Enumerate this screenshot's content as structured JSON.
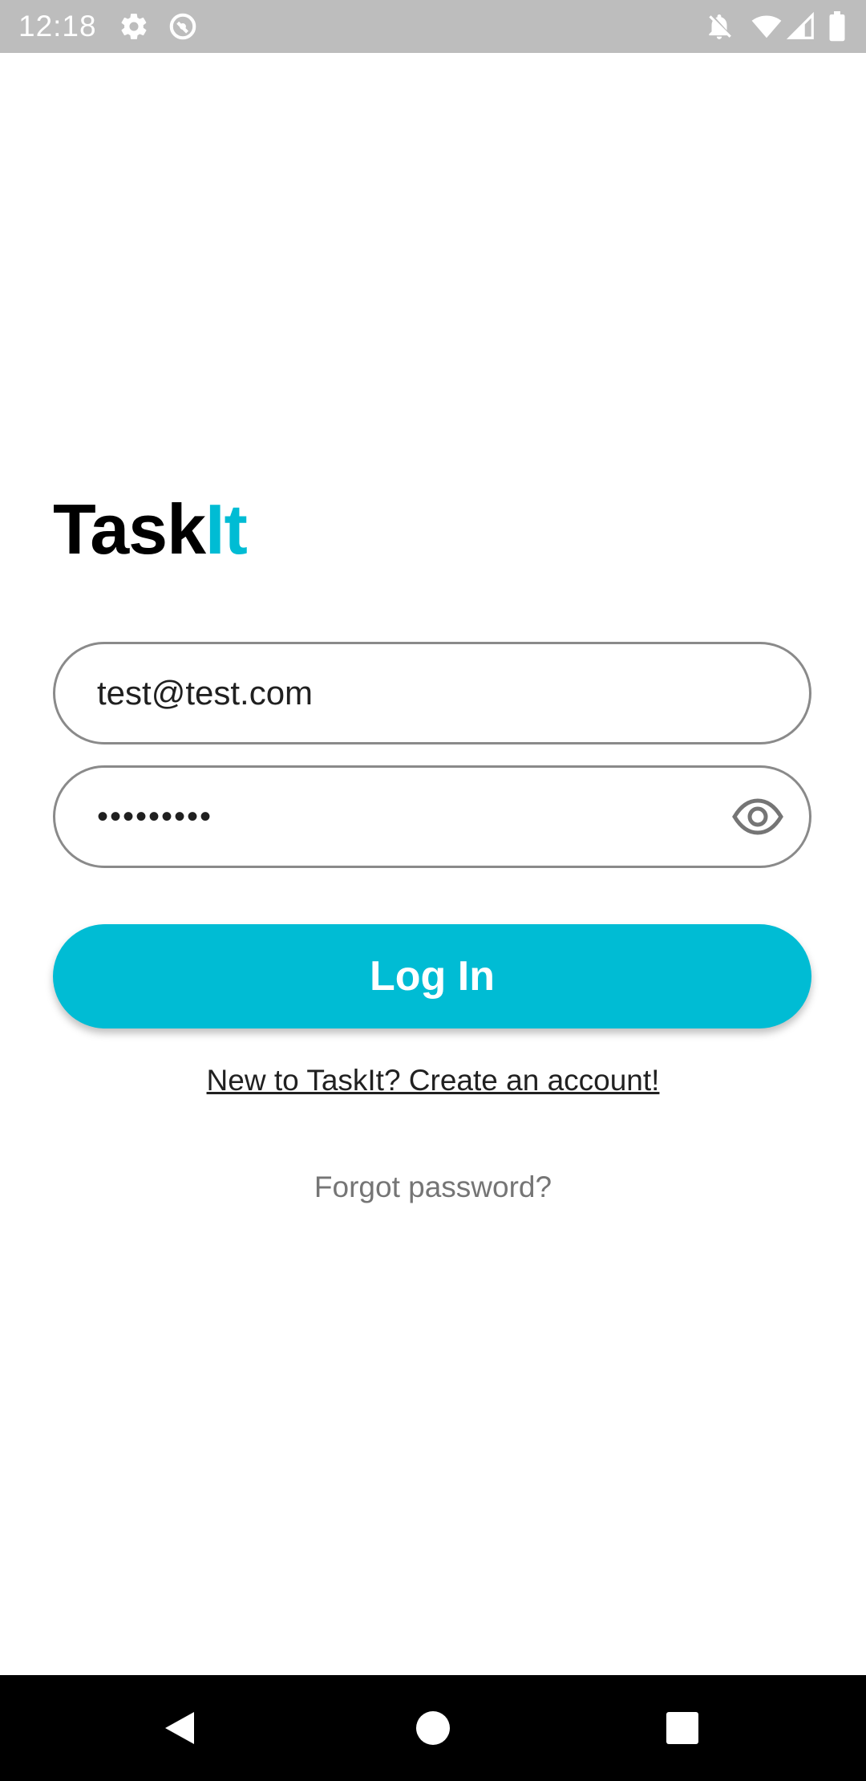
{
  "status_bar": {
    "time": "12:18",
    "left_icons": [
      "gear-icon",
      "sync-icon"
    ],
    "right_icons": [
      "notifications-off-icon",
      "wifi-icon",
      "signal-icon",
      "battery-icon"
    ],
    "background": "#bdbdbd"
  },
  "logo": {
    "part1": "Task",
    "part2": "It",
    "accent_color": "#00bcd4"
  },
  "form": {
    "email_value": "test@test.com",
    "password_value": "•••••••••",
    "password_toggle_icon": "eye-icon",
    "login_label": "Log In",
    "button_color": "#00bcd4"
  },
  "links": {
    "create_account": "New to TaskIt? Create an account!",
    "forgot_password": "Forgot password?"
  },
  "nav_bar": {
    "buttons": [
      "back-icon",
      "home-icon",
      "recents-icon"
    ]
  }
}
